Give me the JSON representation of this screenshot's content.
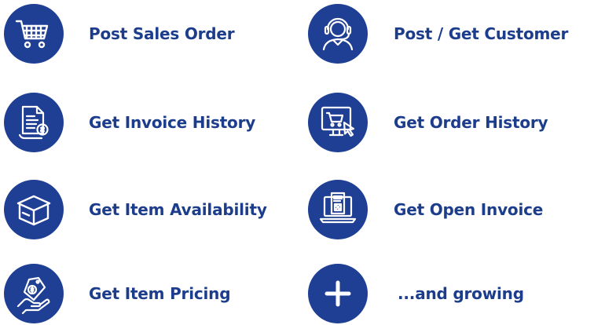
{
  "colors": {
    "icon_circle": "#1f3f95",
    "label_text": "#1c3c8c",
    "icon_stroke": "#ffffff"
  },
  "features": [
    {
      "label": "Post Sales Order",
      "icon": "shopping-cart-icon"
    },
    {
      "label": "Post / Get Customer",
      "icon": "headset-agent-icon"
    },
    {
      "label": "Get Invoice History",
      "icon": "invoice-history-icon"
    },
    {
      "label": "Get Order History",
      "icon": "monitor-cart-icon"
    },
    {
      "label": "Get Item Availability",
      "icon": "box-icon"
    },
    {
      "label": "Get Open Invoice",
      "icon": "laptop-invoice-icon"
    },
    {
      "label": "Get Item Pricing",
      "icon": "hand-price-tag-icon"
    },
    {
      "label": "...and growing",
      "icon": "plus-icon"
    }
  ]
}
